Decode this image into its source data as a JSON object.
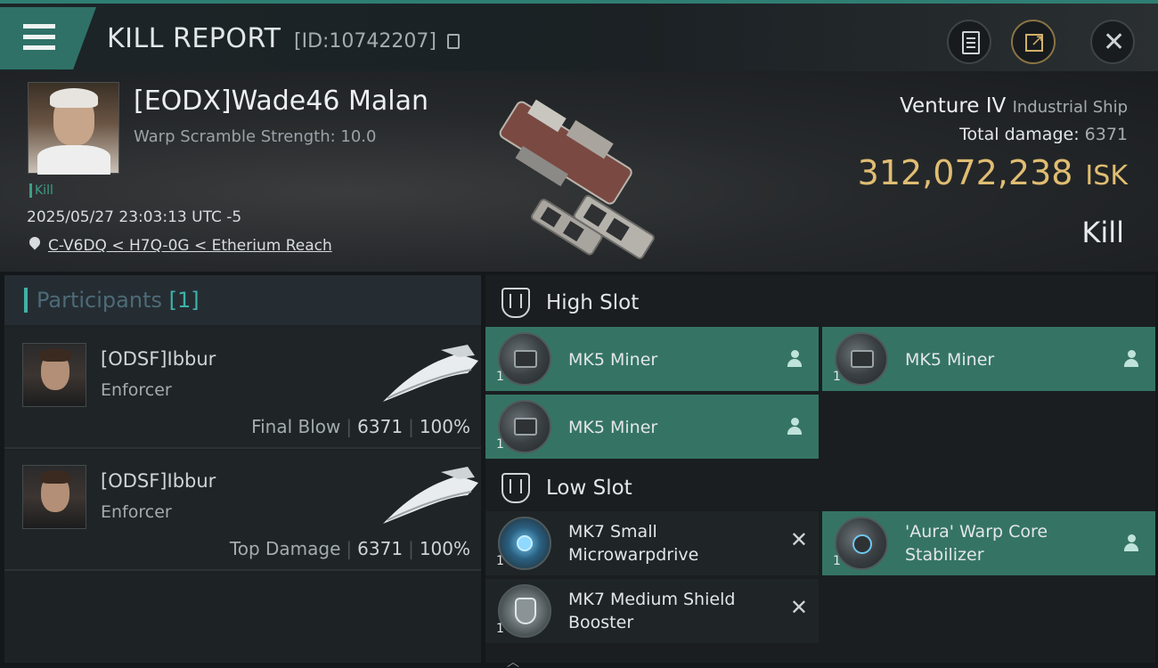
{
  "header": {
    "title": "KILL REPORT",
    "id_text": "[ID:10742207]"
  },
  "victim": {
    "name": "[EODX]Wade46 Malan",
    "warp_scramble": "Warp Scramble Strength: 10.0",
    "kill_tag": "Kill",
    "datetime": "2025/05/27 23:03:13 UTC -5",
    "location": "C-V6DQ < H7Q-0G < Etherium Reach",
    "ship_name": "Venture IV",
    "ship_class": "Industrial Ship",
    "total_damage_label": "Total damage:",
    "total_damage": "6371",
    "isk_value": "312,072,238",
    "isk_unit": "ISK",
    "result": "Kill"
  },
  "participants": {
    "label": "Participants",
    "count": "[1]",
    "rows": [
      {
        "name": "[ODSF]Ibbur",
        "ship": "Enforcer",
        "role": "Final Blow",
        "damage": "6371",
        "percent": "100%"
      },
      {
        "name": "[ODSF]Ibbur",
        "ship": "Enforcer",
        "role": "Top Damage",
        "damage": "6371",
        "percent": "100%"
      }
    ]
  },
  "slots": {
    "high": {
      "label": "High Slot",
      "items": [
        {
          "name": "MK5 Miner",
          "qty": "1",
          "status": "fitted"
        },
        {
          "name": "MK5 Miner",
          "qty": "1",
          "status": "fitted"
        },
        {
          "name": "MK5 Miner",
          "qty": "1",
          "status": "fitted"
        }
      ]
    },
    "low": {
      "label": "Low Slot",
      "items": [
        {
          "name": "MK7 Small Microwarpdrive",
          "qty": "1",
          "status": "destroyed"
        },
        {
          "name": "'Aura' Warp Core Stabilizer",
          "qty": "1",
          "status": "fitted"
        },
        {
          "name": "MK7 Medium Shield Booster",
          "qty": "1",
          "status": "destroyed"
        }
      ]
    }
  },
  "colors": {
    "accent_teal": "#357465",
    "isk_gold": "#e0bd72",
    "kill_green": "#3f9e88"
  }
}
